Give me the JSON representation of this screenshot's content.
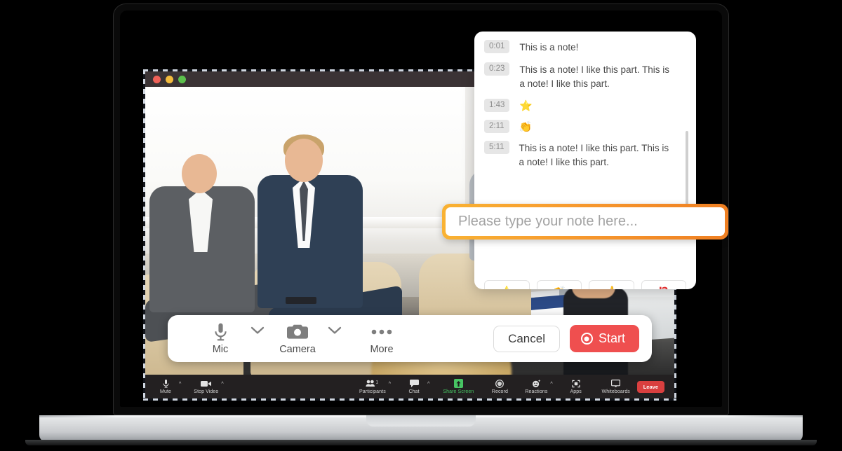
{
  "window": {
    "traffic_lights": [
      "close",
      "minimize",
      "maximize"
    ]
  },
  "notes_panel": {
    "notes": [
      {
        "time": "0:01",
        "text": "This is a note!",
        "emoji": ""
      },
      {
        "time": "0:23",
        "text": "This is a note! I like this part. This is a note! I like this part.",
        "emoji": ""
      },
      {
        "time": "1:43",
        "text": "",
        "emoji": "⭐"
      },
      {
        "time": "2:11",
        "text": "",
        "emoji": "👏"
      },
      {
        "time": "5:11",
        "text": "This is a note! I like this part. This is a note! I like this part.",
        "emoji": ""
      }
    ],
    "emoji_buttons": [
      {
        "name": "star",
        "glyph": "⭐"
      },
      {
        "name": "clap",
        "glyph": "👏"
      },
      {
        "name": "thumbs-up",
        "glyph": "👍"
      },
      {
        "name": "exclamation-question",
        "glyph": "⁉"
      }
    ]
  },
  "note_input": {
    "value": "",
    "placeholder": "Please type your note here...",
    "border_gradient_from": "#f9b233",
    "border_gradient_to": "#ef7f22"
  },
  "record_toolbar": {
    "controls": [
      {
        "label": "Mic",
        "icon": "microphone-icon",
        "has_chevron": true
      },
      {
        "label": "Camera",
        "icon": "camera-icon",
        "has_chevron": true
      },
      {
        "label": "More",
        "icon": "ellipsis-icon",
        "has_chevron": false
      }
    ],
    "cancel_label": "Cancel",
    "start_label": "Start",
    "start_color": "#ef4f4f"
  },
  "zoom_bar": {
    "items": [
      {
        "label": "Mute",
        "icon": "microphone-icon",
        "caret": true,
        "badge": "",
        "accent": false
      },
      {
        "label": "Stop Video",
        "icon": "video-camera-icon",
        "caret": true,
        "badge": "",
        "accent": false
      },
      {
        "label": "Participants",
        "icon": "people-icon",
        "caret": true,
        "badge": "1",
        "accent": false
      },
      {
        "label": "Chat",
        "icon": "chat-bubble-icon",
        "caret": true,
        "badge": "",
        "accent": false
      },
      {
        "label": "Share Screen",
        "icon": "share-screen-icon",
        "caret": false,
        "badge": "",
        "accent": true
      },
      {
        "label": "Record",
        "icon": "record-circle-icon",
        "caret": false,
        "badge": "",
        "accent": false
      },
      {
        "label": "Reactions",
        "icon": "reactions-icon",
        "caret": true,
        "badge": "",
        "accent": false
      },
      {
        "label": "Apps",
        "icon": "apps-icon",
        "caret": false,
        "badge": "",
        "accent": false
      },
      {
        "label": "Whiteboards",
        "icon": "whiteboard-icon",
        "caret": false,
        "badge": "",
        "accent": false
      }
    ],
    "leave_label": "Leave",
    "leave_color": "#d93f3f",
    "accent_color": "#47c363"
  }
}
